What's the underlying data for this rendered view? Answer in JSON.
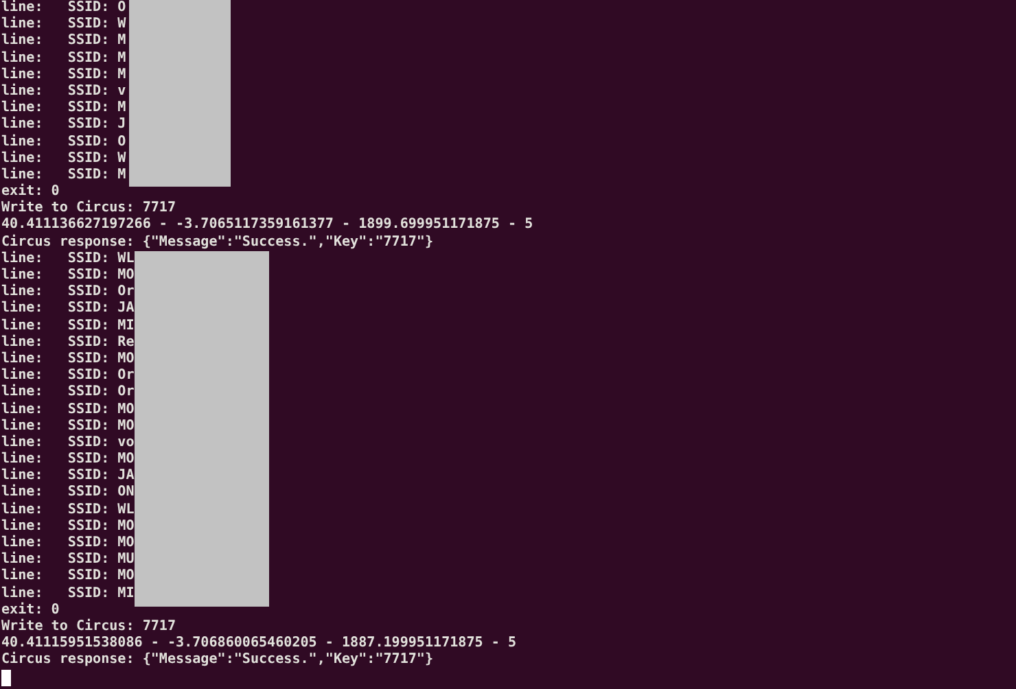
{
  "terminal": {
    "sections": [
      {
        "redacted": true,
        "lines": [
          "line:   SSID: O",
          "line:   SSID: W",
          "line:   SSID: M",
          "line:   SSID: M",
          "line:   SSID: M",
          "line:   SSID: v",
          "line:   SSID: M",
          "line:   SSID: J",
          "line:   SSID: O",
          "line:   SSID: W",
          "line:   SSID: M"
        ]
      },
      {
        "redacted": false,
        "lines": [
          "exit: 0",
          "Write to Circus: 7717",
          "40.411136627197266 - -3.7065117359161377 - 1899.699951171875 - 5",
          "Circus response: {\"Message\":\"Success.\",\"Key\":\"7717\"}"
        ]
      },
      {
        "redacted": true,
        "lines": [
          "line:   SSID: WL",
          "line:   SSID: MO",
          "line:   SSID: Or",
          "line:   SSID: JA",
          "line:   SSID: MI",
          "line:   SSID: Re",
          "line:   SSID: MO",
          "line:   SSID: Or",
          "line:   SSID: Or",
          "line:   SSID: MO",
          "line:   SSID: MO",
          "line:   SSID: vo",
          "line:   SSID: MO",
          "line:   SSID: JA",
          "line:   SSID: ON",
          "line:   SSID: WL",
          "line:   SSID: MO",
          "line:   SSID: MO",
          "line:   SSID: MU",
          "line:   SSID: MO",
          "line:   SSID: MI"
        ]
      },
      {
        "redacted": false,
        "lines": [
          "exit: 0",
          "Write to Circus: 7717",
          "40.41115951538086 - -3.706860065460205 - 1887.199951171875 - 5",
          "Circus response: {\"Message\":\"Success.\",\"Key\":\"7717\"}"
        ]
      }
    ],
    "cursor_visible": true
  }
}
